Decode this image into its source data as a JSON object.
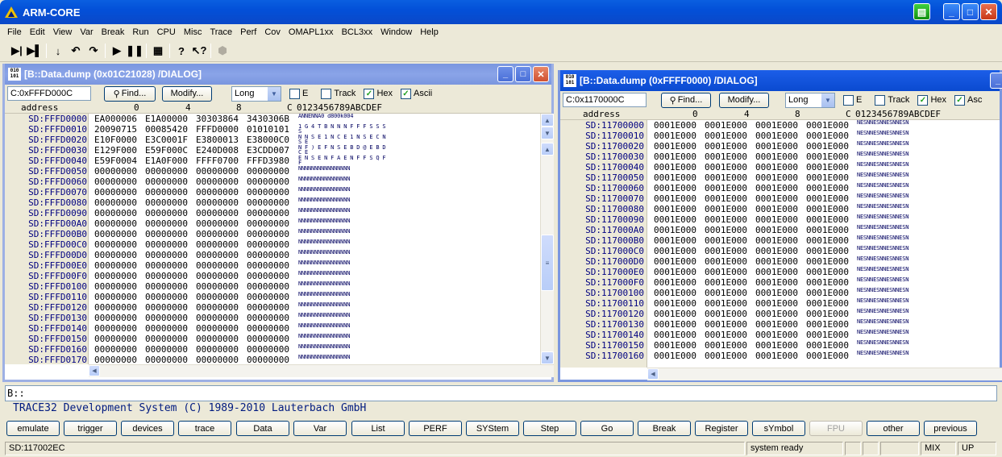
{
  "app": {
    "title": "ARM-CORE"
  },
  "menu": [
    "File",
    "Edit",
    "View",
    "Var",
    "Break",
    "Run",
    "CPU",
    "Misc",
    "Trace",
    "Perf",
    "Cov",
    "OMAPL1xx",
    "BCL3xx",
    "Window",
    "Help"
  ],
  "toolbar": {
    "icons": [
      "step-into-icon",
      "step-over-icon",
      "step-down-icon",
      "step-up-icon",
      "return-icon",
      "go-icon",
      "break-icon",
      "view-list-icon",
      "help-icon",
      "context-help-icon",
      "stop-icon"
    ]
  },
  "win1": {
    "title": "[B::Data.dump (0x01C21028) /DIALOG]",
    "address_input": "C:0xFFFD000C",
    "find_label": "Find...",
    "modify_label": "Modify...",
    "width_select": "Long",
    "checks": [
      {
        "label": "E",
        "checked": false
      },
      {
        "label": "Track",
        "checked": false
      },
      {
        "label": "Hex",
        "checked": true
      },
      {
        "label": "Ascii",
        "checked": true
      }
    ],
    "header": {
      "address": "address",
      "c0": "0",
      "c4": "4",
      "c8": "8",
      "cC": "C",
      "ascii": "0123456789ABCDEF"
    },
    "rows": [
      {
        "a": "SD:FFFD0000",
        "w": [
          "EA000006",
          "E1A00000",
          "30303864",
          "3430306B"
        ],
        "s": "ANNENNA0 d800k004"
      },
      {
        "a": "SD:FFFD0010",
        "w": [
          "20090715",
          "00085420",
          "FFFD0000",
          "01010101"
        ],
        "s": "1 G 4 T B N N N F F F S S S S"
      },
      {
        "a": "SD:FFFD0020",
        "w": [
          "E10F0000",
          "E3C0001F",
          "E3800013",
          "E38000C0"
        ],
        "s": "N N S E 1 N C E 1 N S E C N S E"
      },
      {
        "a": "SD:FFFD0030",
        "w": [
          "E129F000",
          "E59F000C",
          "E240D008",
          "E3CDD007"
        ],
        "s": "N F ) E F N S E B D @ E B D C E"
      },
      {
        "a": "SD:FFFD0040",
        "w": [
          "E59F0004",
          "E1A0F000",
          "FFFF0700",
          "FFFD3980"
        ],
        "s": "E N S E N F A E N F F S Q F F"
      },
      {
        "a": "SD:FFFD0050",
        "w": [
          "00000000",
          "00000000",
          "00000000",
          "00000000"
        ],
        "s": "NNNNNNNNNNNNNNNN"
      },
      {
        "a": "SD:FFFD0060",
        "w": [
          "00000000",
          "00000000",
          "00000000",
          "00000000"
        ],
        "s": "NNNNNNNNNNNNNNNN"
      },
      {
        "a": "SD:FFFD0070",
        "w": [
          "00000000",
          "00000000",
          "00000000",
          "00000000"
        ],
        "s": "NNNNNNNNNNNNNNNN"
      },
      {
        "a": "SD:FFFD0080",
        "w": [
          "00000000",
          "00000000",
          "00000000",
          "00000000"
        ],
        "s": "NNNNNNNNNNNNNNNN"
      },
      {
        "a": "SD:FFFD0090",
        "w": [
          "00000000",
          "00000000",
          "00000000",
          "00000000"
        ],
        "s": "NNNNNNNNNNNNNNNN"
      },
      {
        "a": "SD:FFFD00A0",
        "w": [
          "00000000",
          "00000000",
          "00000000",
          "00000000"
        ],
        "s": "NNNNNNNNNNNNNNNN"
      },
      {
        "a": "SD:FFFD00B0",
        "w": [
          "00000000",
          "00000000",
          "00000000",
          "00000000"
        ],
        "s": "NNNNNNNNNNNNNNNN"
      },
      {
        "a": "SD:FFFD00C0",
        "w": [
          "00000000",
          "00000000",
          "00000000",
          "00000000"
        ],
        "s": "NNNNNNNNNNNNNNNN"
      },
      {
        "a": "SD:FFFD00D0",
        "w": [
          "00000000",
          "00000000",
          "00000000",
          "00000000"
        ],
        "s": "NNNNNNNNNNNNNNNN"
      },
      {
        "a": "SD:FFFD00E0",
        "w": [
          "00000000",
          "00000000",
          "00000000",
          "00000000"
        ],
        "s": "NNNNNNNNNNNNNNNN"
      },
      {
        "a": "SD:FFFD00F0",
        "w": [
          "00000000",
          "00000000",
          "00000000",
          "00000000"
        ],
        "s": "NNNNNNNNNNNNNNNN"
      },
      {
        "a": "SD:FFFD0100",
        "w": [
          "00000000",
          "00000000",
          "00000000",
          "00000000"
        ],
        "s": "NNNNNNNNNNNNNNNN"
      },
      {
        "a": "SD:FFFD0110",
        "w": [
          "00000000",
          "00000000",
          "00000000",
          "00000000"
        ],
        "s": "NNNNNNNNNNNNNNNN"
      },
      {
        "a": "SD:FFFD0120",
        "w": [
          "00000000",
          "00000000",
          "00000000",
          "00000000"
        ],
        "s": "NNNNNNNNNNNNNNNN"
      },
      {
        "a": "SD:FFFD0130",
        "w": [
          "00000000",
          "00000000",
          "00000000",
          "00000000"
        ],
        "s": "NNNNNNNNNNNNNNNN"
      },
      {
        "a": "SD:FFFD0140",
        "w": [
          "00000000",
          "00000000",
          "00000000",
          "00000000"
        ],
        "s": "NNNNNNNNNNNNNNNN"
      },
      {
        "a": "SD:FFFD0150",
        "w": [
          "00000000",
          "00000000",
          "00000000",
          "00000000"
        ],
        "s": "NNNNNNNNNNNNNNNN"
      },
      {
        "a": "SD:FFFD0160",
        "w": [
          "00000000",
          "00000000",
          "00000000",
          "00000000"
        ],
        "s": "NNNNNNNNNNNNNNNN"
      },
      {
        "a": "SD:FFFD0170",
        "w": [
          "00000000",
          "00000000",
          "00000000",
          "00000000"
        ],
        "s": "NNNNNNNNNNNNNNNN"
      }
    ]
  },
  "win2": {
    "title": "[B::Data.dump (0xFFFF0000) /DIALOG]",
    "address_input": "C:0x1170000C",
    "find_label": "Find...",
    "modify_label": "Modify...",
    "width_select": "Long",
    "checks": [
      {
        "label": "E",
        "checked": false
      },
      {
        "label": "Track",
        "checked": false
      },
      {
        "label": "Hex",
        "checked": true
      },
      {
        "label": "Asc",
        "checked": true
      }
    ],
    "header": {
      "address": "address",
      "c0": "0",
      "c4": "4",
      "c8": "8",
      "cC": "C",
      "ascii": "0123456789ABCDEF"
    },
    "rows": [
      {
        "a": "SD:11700000",
        "w": [
          "0001E000",
          "0001E000",
          "0001E000",
          "0001E000"
        ],
        "s": "NESNNESNNESNNESN"
      },
      {
        "a": "SD:11700010",
        "w": [
          "0001E000",
          "0001E000",
          "0001E000",
          "0001E000"
        ],
        "s": "NESNNESNNESNNESN"
      },
      {
        "a": "SD:11700020",
        "w": [
          "0001E000",
          "0001E000",
          "0001E000",
          "0001E000"
        ],
        "s": "NESNNESNNESNNESN"
      },
      {
        "a": "SD:11700030",
        "w": [
          "0001E000",
          "0001E000",
          "0001E000",
          "0001E000"
        ],
        "s": "NESNNESNNESNNESN"
      },
      {
        "a": "SD:11700040",
        "w": [
          "0001E000",
          "0001E000",
          "0001E000",
          "0001E000"
        ],
        "s": "NESNNESNNESNNESN"
      },
      {
        "a": "SD:11700050",
        "w": [
          "0001E000",
          "0001E000",
          "0001E000",
          "0001E000"
        ],
        "s": "NESNNESNNESNNESN"
      },
      {
        "a": "SD:11700060",
        "w": [
          "0001E000",
          "0001E000",
          "0001E000",
          "0001E000"
        ],
        "s": "NESNNESNNESNNESN"
      },
      {
        "a": "SD:11700070",
        "w": [
          "0001E000",
          "0001E000",
          "0001E000",
          "0001E000"
        ],
        "s": "NESNNESNNESNNESN"
      },
      {
        "a": "SD:11700080",
        "w": [
          "0001E000",
          "0001E000",
          "0001E000",
          "0001E000"
        ],
        "s": "NESNNESNNESNNESN"
      },
      {
        "a": "SD:11700090",
        "w": [
          "0001E000",
          "0001E000",
          "0001E000",
          "0001E000"
        ],
        "s": "NESNNESNNESNNESN"
      },
      {
        "a": "SD:117000A0",
        "w": [
          "0001E000",
          "0001E000",
          "0001E000",
          "0001E000"
        ],
        "s": "NESNNESNNESNNESN"
      },
      {
        "a": "SD:117000B0",
        "w": [
          "0001E000",
          "0001E000",
          "0001E000",
          "0001E000"
        ],
        "s": "NESNNESNNESNNESN"
      },
      {
        "a": "SD:117000C0",
        "w": [
          "0001E000",
          "0001E000",
          "0001E000",
          "0001E000"
        ],
        "s": "NESNNESNNESNNESN"
      },
      {
        "a": "SD:117000D0",
        "w": [
          "0001E000",
          "0001E000",
          "0001E000",
          "0001E000"
        ],
        "s": "NESNNESNNESNNESN"
      },
      {
        "a": "SD:117000E0",
        "w": [
          "0001E000",
          "0001E000",
          "0001E000",
          "0001E000"
        ],
        "s": "NESNNESNNESNNESN"
      },
      {
        "a": "SD:117000F0",
        "w": [
          "0001E000",
          "0001E000",
          "0001E000",
          "0001E000"
        ],
        "s": "NESNNESNNESNNESN"
      },
      {
        "a": "SD:11700100",
        "w": [
          "0001E000",
          "0001E000",
          "0001E000",
          "0001E000"
        ],
        "s": "NESNNESNNESNNESN"
      },
      {
        "a": "SD:11700110",
        "w": [
          "0001E000",
          "0001E000",
          "0001E000",
          "0001E000"
        ],
        "s": "NESNNESNNESNNESN"
      },
      {
        "a": "SD:11700120",
        "w": [
          "0001E000",
          "0001E000",
          "0001E000",
          "0001E000"
        ],
        "s": "NESNNESNNESNNESN"
      },
      {
        "a": "SD:11700130",
        "w": [
          "0001E000",
          "0001E000",
          "0001E000",
          "0001E000"
        ],
        "s": "NESNNESNNESNNESN"
      },
      {
        "a": "SD:11700140",
        "w": [
          "0001E000",
          "0001E000",
          "0001E000",
          "0001E000"
        ],
        "s": "NESNNESNNESNNESN"
      },
      {
        "a": "SD:11700150",
        "w": [
          "0001E000",
          "0001E000",
          "0001E000",
          "0001E000"
        ],
        "s": "NESNNESNNESNNESN"
      },
      {
        "a": "SD:11700160",
        "w": [
          "0001E000",
          "0001E000",
          "0001E000",
          "0001E000"
        ],
        "s": "NESNNESNNESNNESN"
      }
    ]
  },
  "command": {
    "prompt": "B::"
  },
  "message": "TRACE32 Development System (C) 1989-2010 Lauterbach GmbH",
  "softkeys": [
    {
      "label": "emulate",
      "enabled": true
    },
    {
      "label": "trigger",
      "enabled": true
    },
    {
      "label": "devices",
      "enabled": true
    },
    {
      "label": "trace",
      "enabled": true
    },
    {
      "label": "Data",
      "enabled": true
    },
    {
      "label": "Var",
      "enabled": true
    },
    {
      "label": "List",
      "enabled": true
    },
    {
      "label": "PERF",
      "enabled": true
    },
    {
      "label": "SYStem",
      "enabled": true
    },
    {
      "label": "Step",
      "enabled": true
    },
    {
      "label": "Go",
      "enabled": true
    },
    {
      "label": "Break",
      "enabled": true
    },
    {
      "label": "Register",
      "enabled": true
    },
    {
      "label": "sYmbol",
      "enabled": true
    },
    {
      "label": "FPU",
      "enabled": false
    },
    {
      "label": "other",
      "enabled": true
    },
    {
      "label": "previous",
      "enabled": true
    }
  ],
  "status": {
    "address": "SD:117002EC",
    "state": "system ready",
    "mode": "MIX",
    "direction": "UP"
  }
}
